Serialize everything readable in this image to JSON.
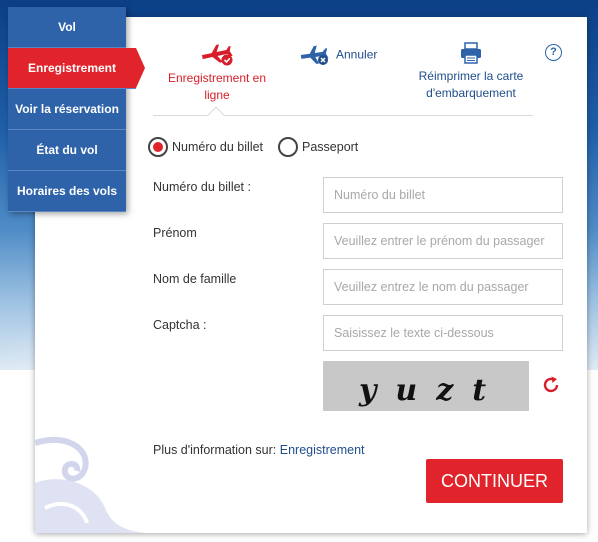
{
  "nav": {
    "items": [
      {
        "label": "Vol"
      },
      {
        "label": "Enregistrement"
      },
      {
        "label": "Voir la réservation"
      },
      {
        "label": "État du vol"
      },
      {
        "label": "Horaires des vols"
      }
    ],
    "active_index": 1
  },
  "tabs": {
    "checkin": {
      "label_line1": "Enregistrement en",
      "label_line2": "ligne",
      "icon": "plane-checkin-icon"
    },
    "cancel": {
      "label": "Annuler",
      "icon": "plane-cancel-icon"
    },
    "reprint": {
      "label_line1": "Réimprimer la carte",
      "label_line2": "d'embarquement",
      "icon": "printer-icon"
    },
    "help": {
      "label": "?"
    }
  },
  "search_by": {
    "options": [
      {
        "label": "Numéro du billet",
        "checked": true
      },
      {
        "label": "Passeport",
        "checked": false
      }
    ]
  },
  "form": {
    "ticket": {
      "label": "Numéro du billet :",
      "placeholder": "Numéro du billet",
      "value": ""
    },
    "first_name": {
      "label": "Prénom",
      "placeholder": "Veuillez entrer le prénom du passager",
      "value": ""
    },
    "last_name": {
      "label": "Nom de famille",
      "placeholder": "Veuillez entrez le nom du passager",
      "value": ""
    },
    "captcha": {
      "label": "Captcha :",
      "placeholder": "Saisissez le texte ci-dessous",
      "value": "",
      "image_text": "yuzt"
    }
  },
  "info": {
    "prefix": "Plus d'information sur:",
    "link": "Enregistrement"
  },
  "continue_label": "CONTINUER",
  "colors": {
    "brand_red": "#e1242b",
    "brand_blue": "#2e63aa",
    "link_blue": "#1f4e8c"
  }
}
